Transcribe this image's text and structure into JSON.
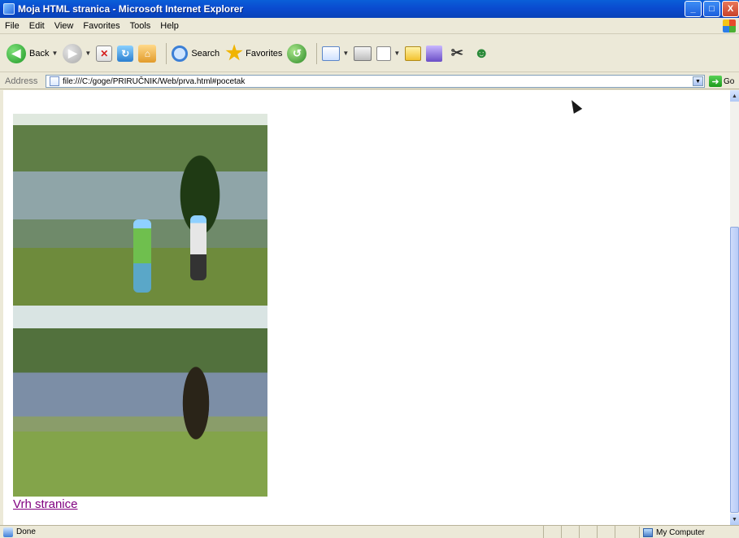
{
  "window": {
    "title": "Moja HTML stranica - Microsoft Internet Explorer",
    "min": "_",
    "max": "□",
    "close": "X"
  },
  "menu": {
    "items": [
      "File",
      "Edit",
      "View",
      "Favorites",
      "Tools",
      "Help"
    ]
  },
  "toolbar": {
    "back": "Back",
    "search": "Search",
    "favorites": "Favorites"
  },
  "address": {
    "label": "Address",
    "url": "file:///C:/goge/PRIRUČNIK/Web/prva.html#pocetak",
    "go": "Go"
  },
  "page": {
    "top_link": "Vrh stranice"
  },
  "status": {
    "text": "Done",
    "zone": "My Computer"
  }
}
